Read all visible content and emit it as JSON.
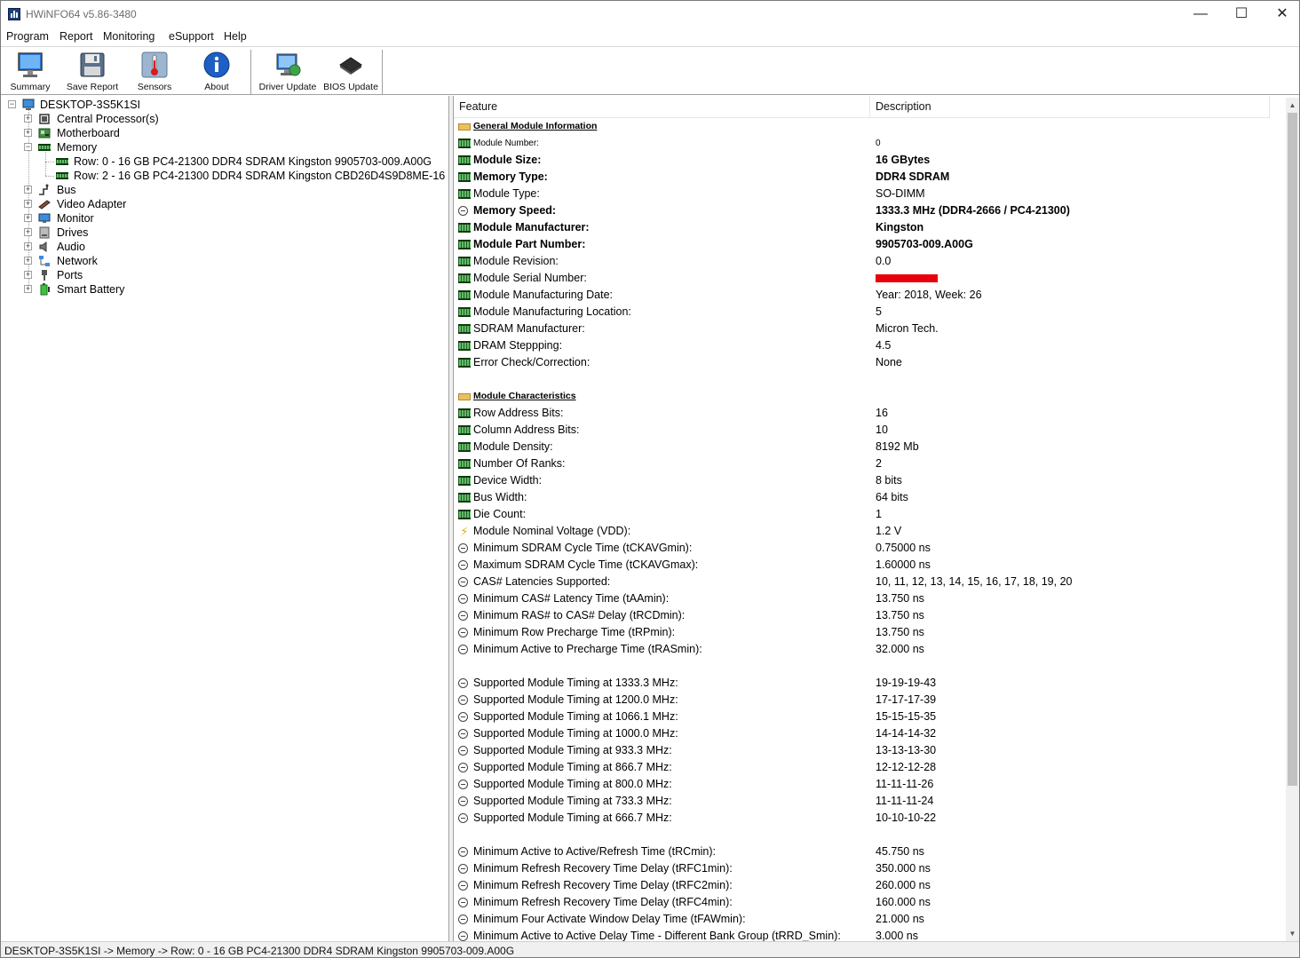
{
  "window": {
    "title": "HWiNFO64 v5.86-3480",
    "minimize_glyph": "—",
    "maximize_glyph": "☐",
    "close_glyph": "✕"
  },
  "menu": [
    "Program",
    "Report",
    "Monitoring",
    "eSupport",
    "Help"
  ],
  "toolbar": {
    "summary": "Summary",
    "save_report": "Save Report",
    "sensors": "Sensors",
    "about": "About",
    "driver_update": "Driver Update",
    "bios_update": "BIOS Update"
  },
  "tree": {
    "root": "DESKTOP-3S5K1SI",
    "nodes": [
      {
        "label": "Central Processor(s)",
        "icon": "cpu-icon"
      },
      {
        "label": "Motherboard",
        "icon": "motherboard-icon"
      },
      {
        "label": "Memory",
        "icon": "memory-icon"
      },
      {
        "label": "Row: 0 - 16 GB PC4-21300 DDR4 SDRAM Kingston 9905703-009.A00G",
        "icon": "memory-module-icon"
      },
      {
        "label": "Row: 2 - 16 GB PC4-21300 DDR4 SDRAM Kingston CBD26D4S9D8ME-16",
        "icon": "memory-module-icon"
      },
      {
        "label": "Bus",
        "icon": "bus-icon"
      },
      {
        "label": "Video Adapter",
        "icon": "video-adapter-icon"
      },
      {
        "label": "Monitor",
        "icon": "monitor-icon"
      },
      {
        "label": "Drives",
        "icon": "drives-icon"
      },
      {
        "label": "Audio",
        "icon": "audio-icon"
      },
      {
        "label": "Network",
        "icon": "network-icon"
      },
      {
        "label": "Ports",
        "icon": "ports-icon"
      },
      {
        "label": "Smart Battery",
        "icon": "battery-icon"
      }
    ]
  },
  "detail": {
    "columns": {
      "feature": "Feature",
      "description": "Description"
    },
    "rows": [
      {
        "feature": "General Module Information",
        "value": "",
        "style": "section",
        "icon": "folder-icon"
      },
      {
        "feature": "Module Number:",
        "value": "0",
        "style": "small",
        "icon": "memory-icon"
      },
      {
        "feature": "Module Size:",
        "value": "16 GBytes",
        "style": "bold",
        "icon": "memory-icon"
      },
      {
        "feature": "Memory Type:",
        "value": "DDR4 SDRAM",
        "style": "bold",
        "icon": "memory-icon"
      },
      {
        "feature": "Module Type:",
        "value": "SO-DIMM",
        "style": "normal",
        "icon": "memory-icon"
      },
      {
        "feature": "Memory Speed:",
        "value": "1333.3 MHz (DDR4-2666 / PC4-21300)",
        "style": "bold",
        "icon": "clock-icon"
      },
      {
        "feature": "Module Manufacturer:",
        "value": "Kingston",
        "style": "bold",
        "icon": "memory-icon"
      },
      {
        "feature": "Module Part Number:",
        "value": "9905703-009.A00G",
        "style": "bold",
        "icon": "memory-icon"
      },
      {
        "feature": "Module Revision:",
        "value": "0.0",
        "style": "normal",
        "icon": "memory-icon"
      },
      {
        "feature": "Module Serial Number:",
        "value": "",
        "style": "redacted",
        "icon": "memory-icon"
      },
      {
        "feature": "Module Manufacturing Date:",
        "value": "Year: 2018, Week: 26",
        "style": "normal",
        "icon": "memory-icon"
      },
      {
        "feature": "Module Manufacturing Location:",
        "value": "5",
        "style": "normal",
        "icon": "memory-icon"
      },
      {
        "feature": "SDRAM Manufacturer:",
        "value": "Micron Tech.",
        "style": "normal",
        "icon": "memory-icon"
      },
      {
        "feature": "DRAM Steppping:",
        "value": "4.5",
        "style": "normal",
        "icon": "memory-icon"
      },
      {
        "feature": "Error Check/Correction:",
        "value": "None",
        "style": "normal",
        "icon": "memory-icon"
      },
      {
        "feature": "",
        "value": "",
        "style": "blank",
        "icon": ""
      },
      {
        "feature": "Module Characteristics",
        "value": "",
        "style": "section",
        "icon": "folder-icon"
      },
      {
        "feature": "Row Address Bits:",
        "value": "16",
        "style": "normal",
        "icon": "memory-icon"
      },
      {
        "feature": "Column Address Bits:",
        "value": "10",
        "style": "normal",
        "icon": "memory-icon"
      },
      {
        "feature": "Module Density:",
        "value": "8192 Mb",
        "style": "normal",
        "icon": "memory-icon"
      },
      {
        "feature": "Number Of Ranks:",
        "value": "2",
        "style": "normal",
        "icon": "memory-icon"
      },
      {
        "feature": "Device Width:",
        "value": "8 bits",
        "style": "normal",
        "icon": "memory-icon"
      },
      {
        "feature": "Bus Width:",
        "value": "64 bits",
        "style": "normal",
        "icon": "memory-icon"
      },
      {
        "feature": "Die Count:",
        "value": "1",
        "style": "normal",
        "icon": "memory-icon"
      },
      {
        "feature": "Module Nominal Voltage (VDD):",
        "value": "1.2 V",
        "style": "normal",
        "icon": "voltage-icon"
      },
      {
        "feature": "Minimum SDRAM Cycle Time (tCKAVGmin):",
        "value": "0.75000 ns",
        "style": "normal",
        "icon": "clock-icon"
      },
      {
        "feature": "Maximum SDRAM Cycle Time (tCKAVGmax):",
        "value": "1.60000 ns",
        "style": "normal",
        "icon": "clock-icon"
      },
      {
        "feature": "CAS# Latencies Supported:",
        "value": "10, 11, 12, 13, 14, 15, 16, 17, 18, 19, 20",
        "style": "normal",
        "icon": "clock-icon"
      },
      {
        "feature": "Minimum CAS# Latency Time (tAAmin):",
        "value": "13.750 ns",
        "style": "normal",
        "icon": "clock-icon"
      },
      {
        "feature": "Minimum RAS# to CAS# Delay (tRCDmin):",
        "value": "13.750 ns",
        "style": "normal",
        "icon": "clock-icon"
      },
      {
        "feature": "Minimum Row Precharge Time (tRPmin):",
        "value": "13.750 ns",
        "style": "normal",
        "icon": "clock-icon"
      },
      {
        "feature": "Minimum Active to Precharge Time (tRASmin):",
        "value": "32.000 ns",
        "style": "normal",
        "icon": "clock-icon"
      },
      {
        "feature": "",
        "value": "",
        "style": "blank",
        "icon": ""
      },
      {
        "feature": "Supported Module Timing at 1333.3 MHz:",
        "value": "19-19-19-43",
        "style": "normal",
        "icon": "clock-icon"
      },
      {
        "feature": "Supported Module Timing at 1200.0 MHz:",
        "value": "17-17-17-39",
        "style": "normal",
        "icon": "clock-icon"
      },
      {
        "feature": "Supported Module Timing at 1066.1 MHz:",
        "value": "15-15-15-35",
        "style": "normal",
        "icon": "clock-icon"
      },
      {
        "feature": "Supported Module Timing at 1000.0 MHz:",
        "value": "14-14-14-32",
        "style": "normal",
        "icon": "clock-icon"
      },
      {
        "feature": "Supported Module Timing at 933.3 MHz:",
        "value": "13-13-13-30",
        "style": "normal",
        "icon": "clock-icon"
      },
      {
        "feature": "Supported Module Timing at 866.7 MHz:",
        "value": "12-12-12-28",
        "style": "normal",
        "icon": "clock-icon"
      },
      {
        "feature": "Supported Module Timing at 800.0 MHz:",
        "value": "11-11-11-26",
        "style": "normal",
        "icon": "clock-icon"
      },
      {
        "feature": "Supported Module Timing at 733.3 MHz:",
        "value": "11-11-11-24",
        "style": "normal",
        "icon": "clock-icon"
      },
      {
        "feature": "Supported Module Timing at 666.7 MHz:",
        "value": "10-10-10-22",
        "style": "normal",
        "icon": "clock-icon"
      },
      {
        "feature": "",
        "value": "",
        "style": "blank",
        "icon": ""
      },
      {
        "feature": "Minimum Active to Active/Refresh Time (tRCmin):",
        "value": "45.750 ns",
        "style": "normal",
        "icon": "clock-icon"
      },
      {
        "feature": "Minimum Refresh Recovery Time Delay (tRFC1min):",
        "value": "350.000 ns",
        "style": "normal",
        "icon": "clock-icon"
      },
      {
        "feature": "Minimum Refresh Recovery Time Delay (tRFC2min):",
        "value": "260.000 ns",
        "style": "normal",
        "icon": "clock-icon"
      },
      {
        "feature": "Minimum Refresh Recovery Time Delay (tRFC4min):",
        "value": "160.000 ns",
        "style": "normal",
        "icon": "clock-icon"
      },
      {
        "feature": "Minimum Four Activate Window Delay Time (tFAWmin):",
        "value": "21.000 ns",
        "style": "normal",
        "icon": "clock-icon"
      },
      {
        "feature": "Minimum Active to Active Delay Time - Different Bank Group (tRRD_Smin):",
        "value": "3.000 ns",
        "style": "normal",
        "icon": "clock-icon"
      }
    ]
  },
  "statusbar": {
    "path": "DESKTOP-3S5K1SI -> Memory -> Row: 0 - 16 GB PC4-21300 DDR4 SDRAM Kingston 9905703-009.A00G"
  },
  "colors": {
    "redaction": "#e8000b",
    "memory_icon": "#2e7d32",
    "tree_selection": "#ffffff"
  }
}
